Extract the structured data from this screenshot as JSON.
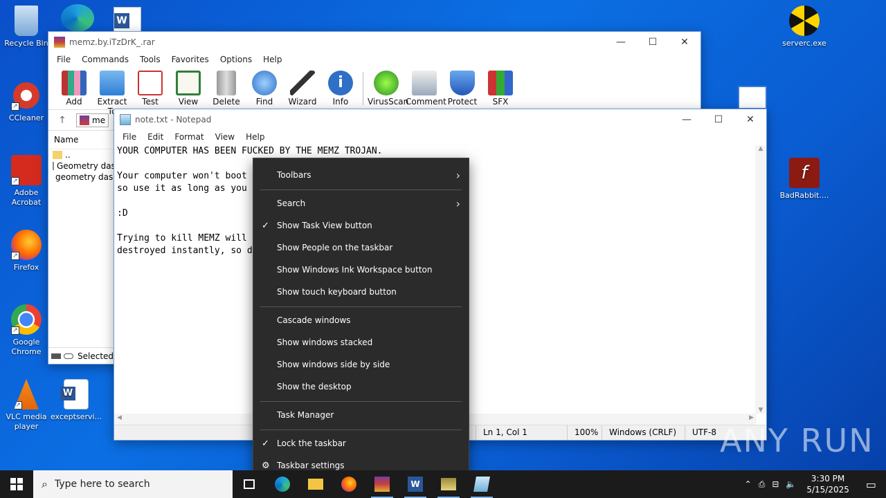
{
  "desktop": {
    "icons_left": [
      {
        "label": "Recycle Bin"
      },
      {
        "label": "CCleaner"
      },
      {
        "label": "Adobe Acrobat"
      },
      {
        "label": "Firefox"
      },
      {
        "label": "Google Chrome"
      },
      {
        "label": "VLC media player"
      },
      {
        "label": "exceptservi..."
      }
    ],
    "icons_right": [
      {
        "label": "serverc.exe"
      },
      {
        "label": "BadRabbit...."
      }
    ]
  },
  "winrar": {
    "title": "memz.by.iTzDrK_.rar",
    "menu": [
      "File",
      "Commands",
      "Tools",
      "Favorites",
      "Options",
      "Help"
    ],
    "toolbar": [
      "Add",
      "Extract To",
      "Test",
      "View",
      "Delete",
      "Find",
      "Wizard",
      "Info",
      "VirusScan",
      "Comment",
      "Protect",
      "SFX"
    ],
    "path_partial": "me",
    "column_name": "Name",
    "files": [
      "..",
      "Geometry das",
      "geometry das"
    ],
    "status": "Selected"
  },
  "notepad": {
    "title": "note.txt - Notepad",
    "menu": [
      "File",
      "Edit",
      "Format",
      "View",
      "Help"
    ],
    "lines": [
      "YOUR COMPUTER HAS BEEN FUCKED BY THE MEMZ TROJAN.",
      "",
      "Your computer won't boot",
      "so use it as long as you",
      "",
      ":D",
      "",
      "Trying to kill MEMZ will",
      "destroyed instantly, so d"
    ],
    "status": {
      "position": "Ln 1, Col 1",
      "zoom": "100%",
      "eol": "Windows (CRLF)",
      "encoding": "UTF-8"
    }
  },
  "context_menu": {
    "items": [
      {
        "label": "Toolbars",
        "submenu": true
      },
      {
        "label": "Search",
        "submenu": true
      },
      {
        "label": "Show Task View button",
        "checked": true
      },
      {
        "label": "Show People on the taskbar"
      },
      {
        "label": "Show Windows Ink Workspace button"
      },
      {
        "label": "Show touch keyboard button"
      },
      {
        "label": "Cascade windows"
      },
      {
        "label": "Show windows stacked"
      },
      {
        "label": "Show windows side by side"
      },
      {
        "label": "Show the desktop"
      },
      {
        "label": "Task Manager"
      },
      {
        "label": "Lock the taskbar",
        "checked": true
      },
      {
        "label": "Taskbar settings",
        "icon": "gear-icon"
      }
    ]
  },
  "taskbar": {
    "search_placeholder": "Type here to search",
    "time": "3:30 PM",
    "date": "5/15/2025"
  },
  "watermark": "ANY RUN"
}
